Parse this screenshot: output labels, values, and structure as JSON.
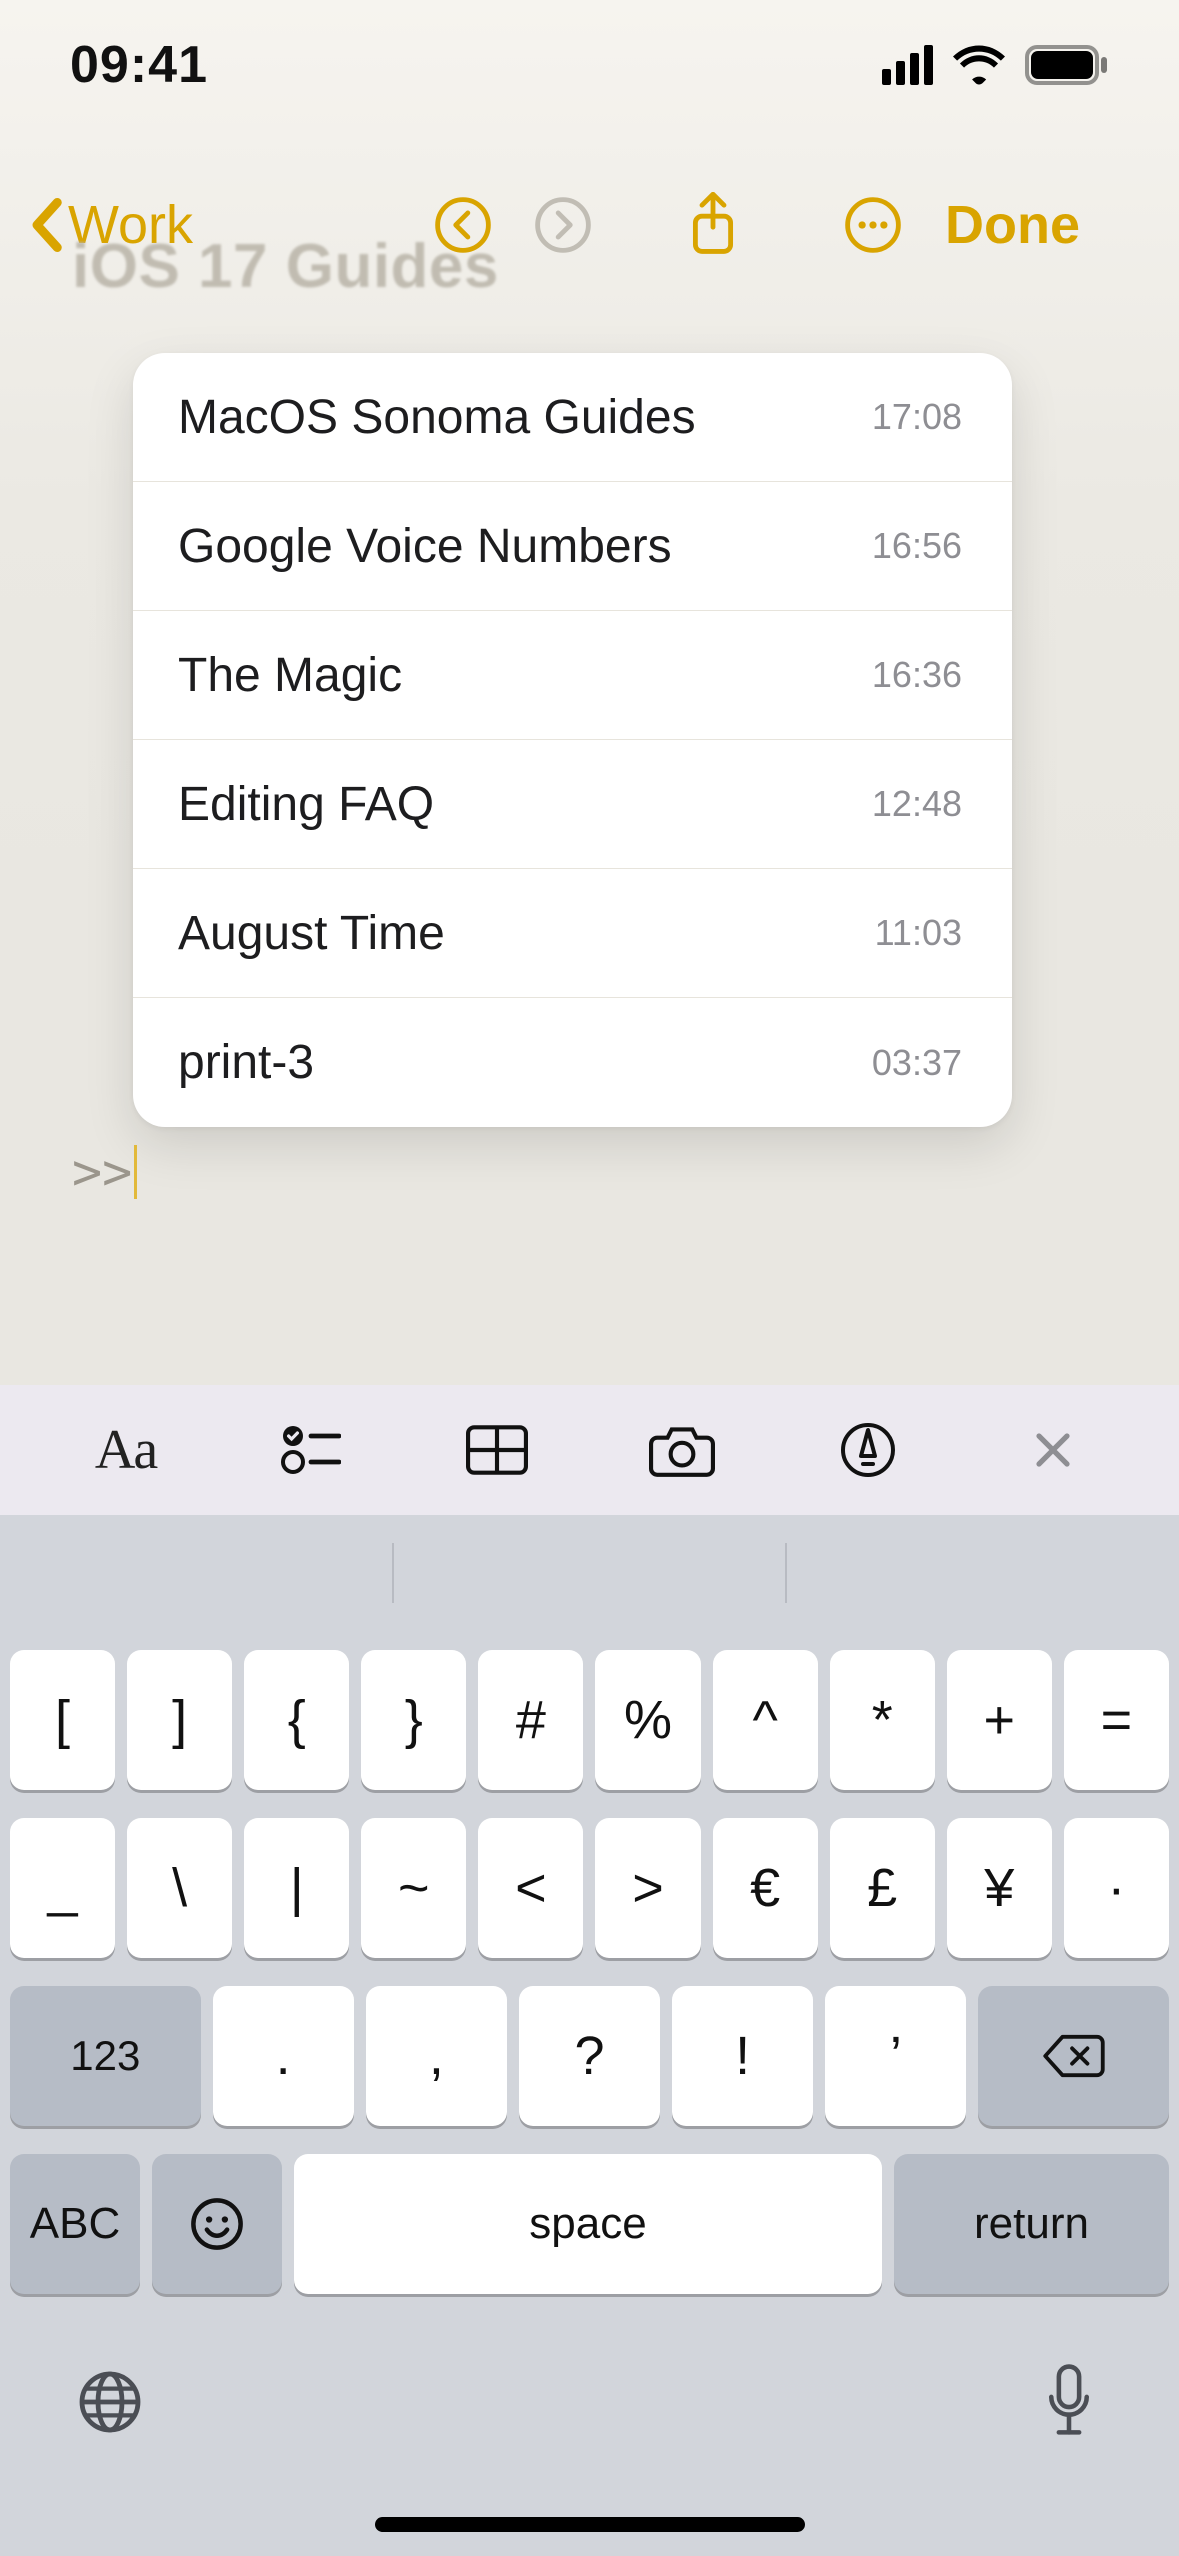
{
  "status": {
    "time": "09:41"
  },
  "nav": {
    "back_label": "Work",
    "done_label": "Done"
  },
  "ghost_title": "iOS 17 Guides",
  "popover": {
    "items": [
      {
        "title": "MacOS Sonoma Guides",
        "time": "17:08"
      },
      {
        "title": "Google Voice Numbers",
        "time": "16:56"
      },
      {
        "title": "The Magic",
        "time": "16:36"
      },
      {
        "title": "Editing FAQ",
        "time": "12:48"
      },
      {
        "title": "August Time",
        "time": "11:03"
      },
      {
        "title": "print-3",
        "time": "03:37"
      }
    ]
  },
  "editor": {
    "line_prefix": ">>"
  },
  "accessory": {
    "aa_label": "Aa"
  },
  "keyboard": {
    "row1": [
      "[",
      "]",
      "{",
      "}",
      "#",
      "%",
      "^",
      "*",
      "+",
      "="
    ],
    "row2": [
      "_",
      "\\",
      "|",
      "~",
      "<",
      ">",
      "€",
      "£",
      "¥",
      "·"
    ],
    "row3": {
      "shift": "123",
      "keys": [
        ".",
        ",",
        "?",
        "!",
        "’"
      ],
      "backspace": "⌫"
    },
    "row4": {
      "abc": "ABC",
      "space": "space",
      "return": "return"
    }
  }
}
